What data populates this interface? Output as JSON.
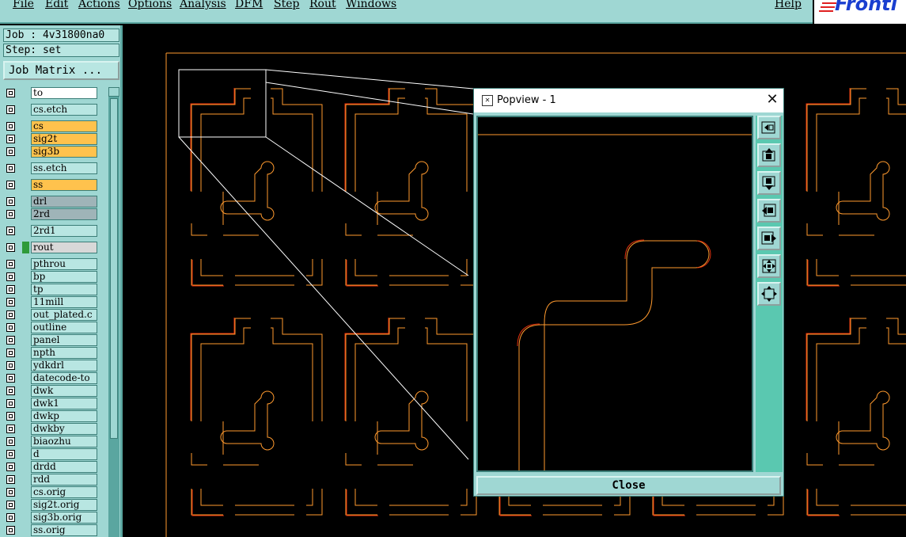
{
  "menubar": {
    "items": [
      "File",
      "Edit",
      "Actions",
      "Options",
      "Analysis",
      "DFM",
      "Step",
      "Rout",
      "Windows"
    ],
    "help": "Help",
    "logo": "Fronti"
  },
  "leftpanel": {
    "job": "Job : 4v31800na0",
    "step": "Step: set",
    "job_matrix": "Job Matrix ...",
    "layers": [
      {
        "name": "to",
        "color": "#ffffff"
      },
      {
        "name": "cs.etch",
        "color": "#b8e6e2"
      },
      {
        "name": "cs",
        "color": "#ffc24d"
      },
      {
        "name": "sig2t",
        "color": "#ffc24d"
      },
      {
        "name": "sig3b",
        "color": "#ffc24d"
      },
      {
        "name": "ss.etch",
        "color": "#b8e6e2"
      },
      {
        "name": "ss",
        "color": "#ffc24d"
      },
      {
        "name": "drl",
        "color": "#9fb4b8"
      },
      {
        "name": "2rd",
        "color": "#9fb4b8"
      },
      {
        "name": "2rd1",
        "color": "#b8e6e2"
      },
      {
        "name": "rout",
        "color": "#d8d8d8",
        "indicator": "#2f9a3a"
      },
      {
        "name": "pthrou",
        "color": "#b8e6e2"
      },
      {
        "name": "bp",
        "color": "#b8e6e2"
      },
      {
        "name": "tp",
        "color": "#b8e6e2"
      },
      {
        "name": "11mill",
        "color": "#b8e6e2"
      },
      {
        "name": "out_plated.c",
        "color": "#b8e6e2"
      },
      {
        "name": "outline",
        "color": "#b8e6e2"
      },
      {
        "name": "panel",
        "color": "#b8e6e2"
      },
      {
        "name": "npth",
        "color": "#b8e6e2"
      },
      {
        "name": "ydkdrl",
        "color": "#b8e6e2"
      },
      {
        "name": "datecode-to",
        "color": "#b8e6e2"
      },
      {
        "name": "dwk",
        "color": "#b8e6e2"
      },
      {
        "name": "dwk1",
        "color": "#b8e6e2"
      },
      {
        "name": "dwkp",
        "color": "#b8e6e2"
      },
      {
        "name": "dwkby",
        "color": "#b8e6e2"
      },
      {
        "name": "biaozhu",
        "color": "#b8e6e2"
      },
      {
        "name": "d",
        "color": "#b8e6e2"
      },
      {
        "name": "drdd",
        "color": "#b8e6e2"
      },
      {
        "name": "rdd",
        "color": "#b8e6e2"
      },
      {
        "name": "cs.orig",
        "color": "#b8e6e2"
      },
      {
        "name": "sig2t.orig",
        "color": "#b8e6e2"
      },
      {
        "name": "sig3b.orig",
        "color": "#b8e6e2"
      },
      {
        "name": "ss.orig",
        "color": "#b8e6e2"
      }
    ]
  },
  "popup": {
    "title": "Popview - 1",
    "close_label": "Close",
    "side_buttons": [
      "zoom-back-icon",
      "pan-up-icon",
      "pan-down-icon",
      "pan-left-icon",
      "pan-right-icon",
      "zoom-fit-icon",
      "zoom-home-icon"
    ]
  },
  "colors": {
    "panel": "#9fd7d3",
    "trace": "#ff9a2e",
    "trace_outline": "#e0300e",
    "rout": "#ffc24d"
  }
}
